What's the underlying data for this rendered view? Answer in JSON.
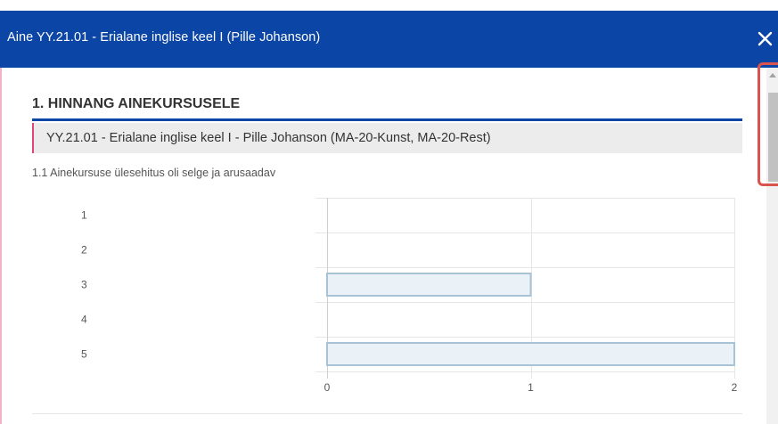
{
  "modal": {
    "title": "Aine YY.21.01 - Erialane inglise keel I (Pille Johanson)",
    "close_icon": "close-icon"
  },
  "section": {
    "title": "1. HINNANG AINEKURSUSELE",
    "course_label": "YY.21.01 - Erialane inglise keel I - Pille Johanson (MA-20-Kunst, MA-20-Rest)"
  },
  "question": {
    "label": "1.1 Ainekursuse ülesehitus oli selge ja arusaadav"
  },
  "colors": {
    "header": "#0b45a5",
    "bar_fill": "#eaf1f7",
    "bar_stroke": "#a7c4d6",
    "highlight": "#d9534f"
  },
  "chart_data": {
    "type": "bar",
    "orientation": "horizontal",
    "categories": [
      "1",
      "2",
      "3",
      "4",
      "5"
    ],
    "values": [
      0,
      0,
      1,
      0,
      2
    ],
    "xlim": [
      0,
      2
    ],
    "x_ticks": [
      "0",
      "1",
      "2"
    ],
    "grid": true
  }
}
